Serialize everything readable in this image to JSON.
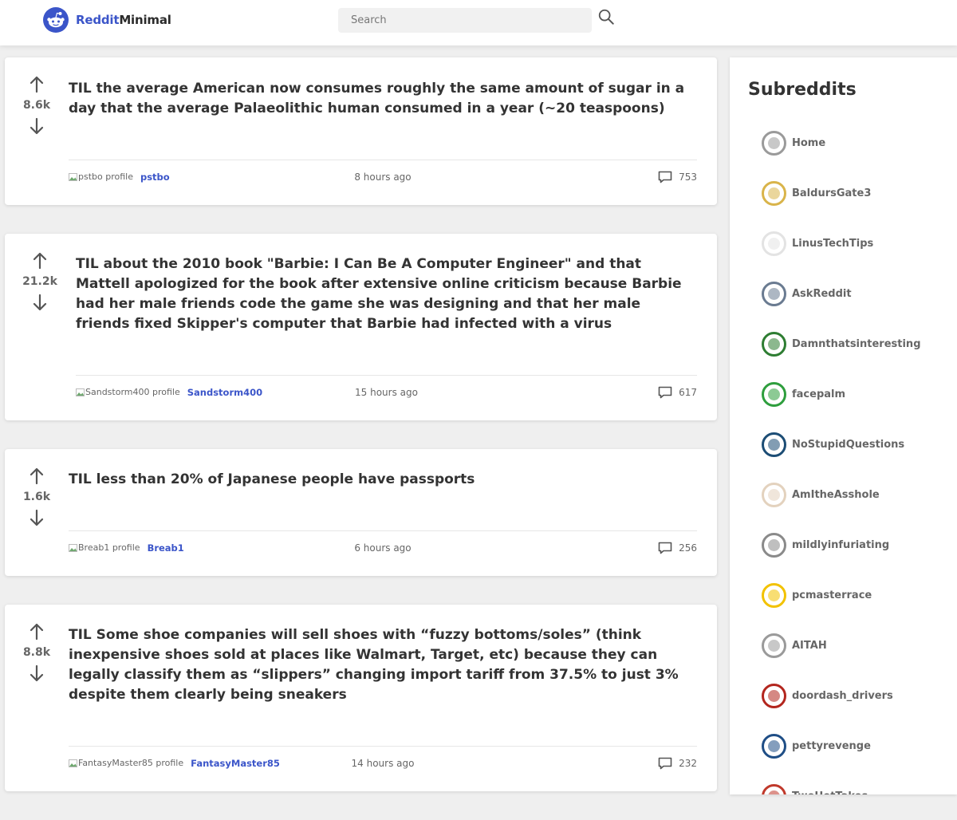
{
  "header": {
    "logo_prefix": "Reddit",
    "logo_suffix": "Minimal",
    "search_placeholder": "Search",
    "brand_color": "#3b55c9"
  },
  "posts": [
    {
      "title": "TIL the average American now consumes roughly the same amount of sugar in a day that the average Palaeolithic human consumed in a year (~20 teaspoons)",
      "votes": "8.6k",
      "author": "pstbo",
      "avatar_alt": "pstbo profile",
      "time": "8 hours ago",
      "comments": "753"
    },
    {
      "title": "TIL about the 2010 book \"Barbie: I Can Be A Computer Engineer\" and that Mattell apologized for the book after extensive online criticism because Barbie had her male friends code the game she was designing and that her male friends fixed Skipper's computer that Barbie had infected with a virus",
      "votes": "21.2k",
      "author": "Sandstorm400",
      "avatar_alt": "Sandstorm400 profile",
      "time": "15 hours ago",
      "comments": "617"
    },
    {
      "title": "TIL less than 20% of Japanese people have passports",
      "votes": "1.6k",
      "author": "Breab1",
      "avatar_alt": "Breab1 profile",
      "time": "6 hours ago",
      "comments": "256"
    },
    {
      "title": "TIL Some shoe companies will sell shoes with “fuzzy bottoms/soles” (think inexpensive shoes sold at places like Walmart, Target, etc) because they can legally classify them as “slippers” changing import tariff from 37.5% to just 3% despite them clearly being sneakers",
      "votes": "8.8k",
      "author": "FantasyMaster85",
      "avatar_alt": "FantasyMaster85 profile",
      "time": "14 hours ago",
      "comments": "232"
    }
  ],
  "sidebar": {
    "title": "Subreddits",
    "items": [
      {
        "name": "Home",
        "color": "#9a9a9a",
        "icon": "home-icon"
      },
      {
        "name": "BaldursGate3",
        "color": "#d9b44a",
        "icon": "baldursgate3-icon"
      },
      {
        "name": "LinusTechTips",
        "color": "#e3e3e3",
        "icon": "linustechtips-icon"
      },
      {
        "name": "AskReddit",
        "color": "#6a7b91",
        "icon": "askreddit-icon"
      },
      {
        "name": "Damnthatsinteresting",
        "color": "#2e7d32",
        "icon": "damnthatsinteresting-icon"
      },
      {
        "name": "facepalm",
        "color": "#2e9e3d",
        "icon": "facepalm-icon"
      },
      {
        "name": "NoStupidQuestions",
        "color": "#1c4d75",
        "icon": "nostupidquestions-icon"
      },
      {
        "name": "AmItheAsshole",
        "color": "#e3d2be",
        "icon": "amitheasshole-icon"
      },
      {
        "name": "mildlyinfuriating",
        "color": "#8a8a8a",
        "icon": "mildlyinfuriating-icon"
      },
      {
        "name": "pcmasterrace",
        "color": "#f2c200",
        "icon": "pcmasterrace-icon"
      },
      {
        "name": "AITAH",
        "color": "#9a9a9a",
        "icon": "aitah-icon"
      },
      {
        "name": "doordash_drivers",
        "color": "#b3261e",
        "icon": "doordash-icon"
      },
      {
        "name": "pettyrevenge",
        "color": "#1f4e86",
        "icon": "pettyrevenge-icon"
      },
      {
        "name": "TwoHotTakes",
        "color": "#c0392b",
        "icon": "twohottakes-icon"
      }
    ]
  }
}
